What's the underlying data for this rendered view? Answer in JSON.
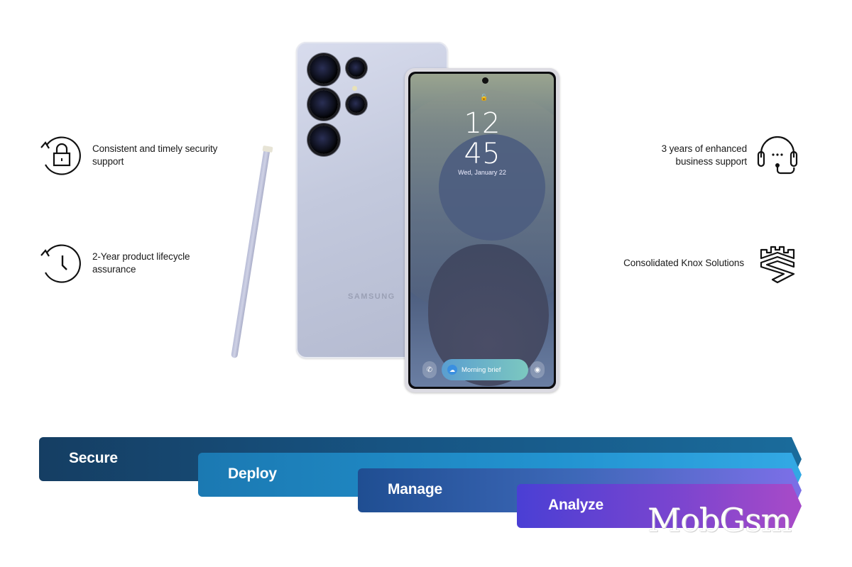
{
  "features": [
    {
      "text": "Consistent and timely security support",
      "icon": "lock-refresh-icon"
    },
    {
      "text": "2-Year product lifecycle assurance",
      "icon": "clock-refresh-icon"
    },
    {
      "text": "3 years of enhanced business support",
      "icon": "headset-icon"
    },
    {
      "text": "Consolidated Knox Solutions",
      "icon": "knox-shield-icon"
    }
  ],
  "phone_back": {
    "brand": "SAMSUNG"
  },
  "phone_front": {
    "clock_hours": "12",
    "clock_minutes": "45",
    "date": "Wed, January 22",
    "pill_label": "Morning brief",
    "lock_glyph": "🔓",
    "phone_glyph": "✆",
    "camera_glyph": "◉",
    "pill_glyph": "☁"
  },
  "stages": [
    {
      "label": "Secure",
      "color": "#175584"
    },
    {
      "label": "Deploy",
      "color": "#2293d0"
    },
    {
      "label": "Manage",
      "color": "#3d68b8"
    },
    {
      "label": "Analyze",
      "color": "#7c45cf"
    }
  ],
  "watermark": "MobGsm"
}
